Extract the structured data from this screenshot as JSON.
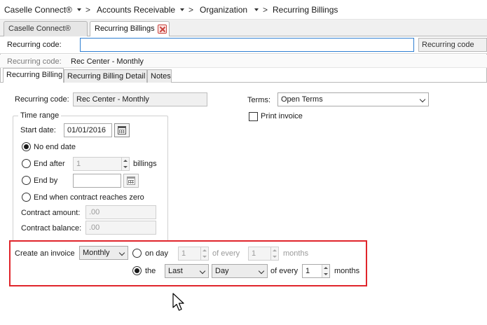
{
  "breadcrumb": {
    "items": [
      "Caselle Connect®",
      "Accounts Receivable",
      "Organization",
      "Recurring Billings"
    ],
    "separator": ">"
  },
  "doc_tabs": [
    {
      "label": "Caselle Connect®",
      "active": false
    },
    {
      "label": "Recurring Billings",
      "active": true
    }
  ],
  "search": {
    "label": "Recurring code:",
    "value": "",
    "type_label": "Recurring code"
  },
  "current": {
    "label": "Recurring code:",
    "value": "Rec Center - Monthly"
  },
  "form_tabs": [
    {
      "label": "Recurring Billing",
      "active": true
    },
    {
      "label": "Recurring Billing Detail",
      "active": false
    },
    {
      "label": "Notes",
      "active": false
    }
  ],
  "form": {
    "recurring_code_label": "Recurring code:",
    "recurring_code_value": "Rec Center - Monthly",
    "terms_label": "Terms:",
    "terms_value": "Open Terms",
    "print_invoice_label": "Print invoice",
    "print_invoice_checked": false,
    "time_range": {
      "title": "Time range",
      "start_date_label": "Start date:",
      "start_date_value": "01/01/2016",
      "no_end_date_label": "No end date",
      "no_end_date_selected": true,
      "end_after_label": "End after",
      "end_after_value": "1",
      "billings_label": "billings",
      "end_by_label": "End by",
      "end_by_value": "",
      "end_contract_label": "End when contract reaches zero",
      "contract_amount_label": "Contract amount:",
      "contract_amount_value": ".00",
      "contract_balance_label": "Contract balance:",
      "contract_balance_value": ".00"
    },
    "invoice": {
      "create_label": "Create an invoice",
      "frequency_value": "Monthly",
      "on_day_label": "on day",
      "on_day_value": "1",
      "of_every_label_1": "of every",
      "of_every_value_1": "1",
      "months_label_1": "months",
      "the_label": "the",
      "the_selected": true,
      "ordinal_value": "Last",
      "day_value": "Day",
      "of_every_label_2": "of every",
      "of_every_value_2": "1",
      "months_label_2": "months"
    }
  },
  "colors": {
    "highlight": "#e0252b",
    "focus_border": "#2f7fd2",
    "close_icon": "#c9423d"
  }
}
